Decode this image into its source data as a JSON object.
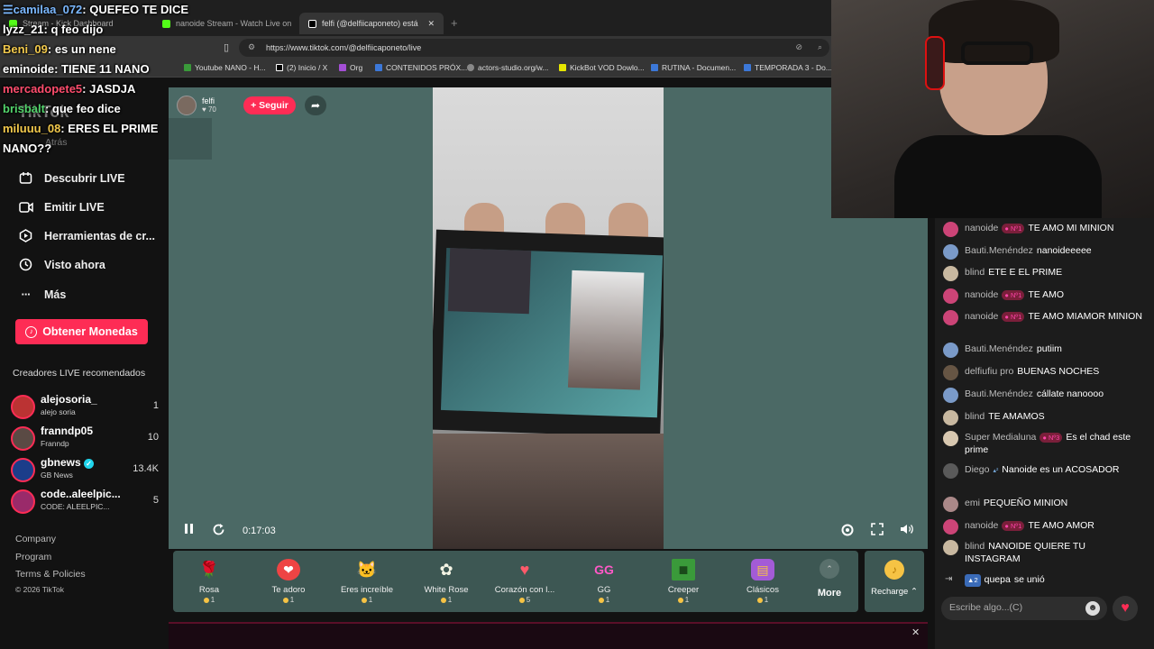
{
  "browser": {
    "tabs": [
      {
        "label": "Stream - Kick Dashboard"
      },
      {
        "label": "nanoide Stream - Watch Live on"
      },
      {
        "label": "felfi (@delfiicaponeto) está LIVE"
      }
    ],
    "url": "https://www.tiktok.com/@delfiicaponeto/live",
    "bookmarks": [
      "Youtube NANO - H...",
      "(2) Inicio / X",
      "Org",
      "CONTENIDOS PRÓX...",
      "actors-studio.org/w...",
      "KickBot VOD Dowlo...",
      "RUTINA - Documen...",
      "TEMPORADA 3 - Do..."
    ]
  },
  "overlay_chat": [
    {
      "user": "camilaa_072",
      "text": "QUEFEO TE DICE",
      "color": "#7bb8ff"
    },
    {
      "user": "lyzz_21",
      "text": "q feo dijo",
      "color": "#ffffff"
    },
    {
      "user": "Beni_09",
      "text": "es un nene",
      "color": "#f2c94c"
    },
    {
      "user": "eminoide",
      "text": "TIENE 11 NANO",
      "color": "#ffffff"
    },
    {
      "user": "mercadopete5",
      "text": "JASDJA",
      "color": "#ff4d6d"
    },
    {
      "user": "brisbalt",
      "text": "que feo dice",
      "color": "#52d36b"
    },
    {
      "user": "miluuu_08",
      "text": "ERES EL PRIME NANO??",
      "color": "#f2c94c"
    }
  ],
  "sidebar": {
    "logo": "TikTok",
    "back_label": "Atrás",
    "nav": [
      {
        "label": "Descubrir LIVE",
        "icon": "calendar-icon"
      },
      {
        "label": "Emitir LIVE",
        "icon": "video-camera-icon"
      },
      {
        "label": "Herramientas de cr...",
        "icon": "creator-tools-icon"
      },
      {
        "label": "Visto ahora",
        "icon": "history-icon"
      },
      {
        "label": "Más",
        "icon": "more-dots-icon"
      }
    ],
    "coins_button": "Obtener Monedas",
    "recommended_title": "Creadores LIVE recomendados",
    "creators": [
      {
        "name": "alejosoria_",
        "sub": "alejo soria",
        "count": "1",
        "color": "#b33"
      },
      {
        "name": "franndp05",
        "sub": "Franndp",
        "count": "10",
        "color": "#5a4a44"
      },
      {
        "name": "gbnews",
        "sub": "GB News",
        "count": "13.4K",
        "color": "#1b3d8a"
      },
      {
        "name": "code..aleelpic...",
        "sub": "CODE: ALEELPIC...",
        "count": "5",
        "color": "#9a2a6a"
      }
    ],
    "footer": [
      "Company",
      "Program",
      "Terms & Policies",
      "© 2026 TikTok"
    ]
  },
  "player": {
    "host_name": "felfi",
    "host_likes": "70",
    "follow_label": "+ Seguir",
    "time": "0:17:03"
  },
  "gifts": [
    {
      "name": "Rosa",
      "cost": "1",
      "icon": "🌹",
      "bg": "transparent"
    },
    {
      "name": "Te adoro",
      "cost": "1",
      "icon": "❤",
      "bg": "#e44"
    },
    {
      "name": "Eres increíble",
      "cost": "1",
      "icon": "🐱",
      "bg": "transparent"
    },
    {
      "name": "White Rose",
      "cost": "1",
      "icon": "✿",
      "bg": "transparent"
    },
    {
      "name": "Corazón con l...",
      "cost": "5",
      "icon": "♥",
      "bg": "transparent"
    },
    {
      "name": "GG",
      "cost": "1",
      "icon": "GG",
      "bg": "transparent"
    },
    {
      "name": "Creeper",
      "cost": "1",
      "icon": "■",
      "bg": "#3a9a3a"
    },
    {
      "name": "Clásicos",
      "cost": "1",
      "icon": "▤",
      "bg": "#a35bd6"
    }
  ],
  "more_label": "More",
  "recharge_label": "Recharge",
  "chat": {
    "messages": [
      {
        "user": "nanoide",
        "badge": "Nº1",
        "text": "TE AMO MI MINION",
        "av": "#c47"
      },
      {
        "user": "Bauti.Menéndez",
        "badge": "",
        "text": "nanoideeeee",
        "av": "#7a9ac8"
      },
      {
        "user": "blind",
        "badge": "",
        "text": "ETE E EL PRIME",
        "av": "#c8b8a0"
      },
      {
        "user": "nanoide",
        "badge": "Nº1",
        "text": "TE AMO",
        "av": "#c47"
      },
      {
        "user": "nanoide",
        "badge": "Nº1",
        "text": "TE AMO MIAMOR MINION",
        "av": "#c47"
      },
      {
        "user": "Bauti.Menéndez",
        "badge": "",
        "text": "putiim",
        "av": "#7a9ac8"
      },
      {
        "user": "delfiufiu pro",
        "badge": "",
        "text": "BUENAS NOCHES",
        "av": "#665544"
      },
      {
        "user": "Bauti.Menéndez",
        "badge": "",
        "text": "cállate nanoooo",
        "av": "#7a9ac8"
      },
      {
        "user": "blind",
        "badge": "",
        "text": "TE AMAMOS",
        "av": "#c8b8a0"
      },
      {
        "user": "Super Medialuna",
        "badge": "Nº3",
        "text": "Es el chad este prime",
        "av": "#d8c8b0"
      },
      {
        "user": "Diego",
        "badge": "",
        "text": "Nanoide es un ACOSADOR",
        "av": "#5a5a5a"
      },
      {
        "user": "emi",
        "badge": "",
        "text": "PEQUEÑO MINION",
        "av": "#aa8888"
      },
      {
        "user": "nanoide",
        "badge": "Nº1",
        "text": "TE AMO AMOR",
        "av": "#c47"
      },
      {
        "user": "blind",
        "badge": "",
        "text": "NANOIDE QUIERE TU INSTAGRAM",
        "av": "#c8b8a0"
      }
    ],
    "join_level": "2",
    "join_user": "quepa",
    "join_text": "se unió",
    "input_placeholder": "Escribe algo...(C)"
  }
}
